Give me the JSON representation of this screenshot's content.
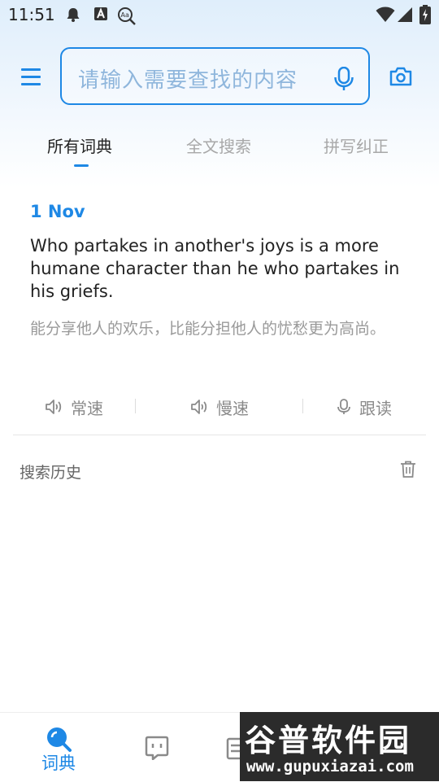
{
  "status_bar": {
    "time": "11:51",
    "icons": [
      "notification-bell-icon",
      "font-a-icon",
      "text-search-icon",
      "wifi-icon",
      "signal-icon",
      "battery-charging-icon"
    ]
  },
  "header": {
    "search_placeholder": "请输入需要查找的内容",
    "icons": [
      "menu-icon",
      "microphone-icon",
      "camera-icon"
    ],
    "accent_color": "#1e88e5"
  },
  "tabs": [
    {
      "label": "所有词典",
      "active": true
    },
    {
      "label": "全文搜索",
      "active": false
    },
    {
      "label": "拼写纠正",
      "active": false
    }
  ],
  "daily_sentence": {
    "date": "1 Nov",
    "english": "Who partakes in another's joys is a more humane character than he who partakes in his griefs.",
    "chinese": "能分享他人的欢乐，比能分担他人的忧愁更为高尚。",
    "actions": [
      {
        "label": "常速",
        "icon": "speaker-icon"
      },
      {
        "label": "慢速",
        "icon": "speaker-icon"
      },
      {
        "label": "跟读",
        "icon": "microphone-icon"
      }
    ]
  },
  "history": {
    "title": "搜索历史",
    "icon": "trash-icon"
  },
  "bottom_nav": {
    "items": [
      {
        "label": "词典",
        "icon": "search-icon",
        "active": true
      },
      {
        "label": "",
        "icon": "chat-icon",
        "active": false
      },
      {
        "label": "",
        "icon": "list-icon",
        "active": false
      }
    ]
  },
  "watermark": {
    "title": "谷普软件园",
    "url": "www.gupuxiazai.com"
  }
}
